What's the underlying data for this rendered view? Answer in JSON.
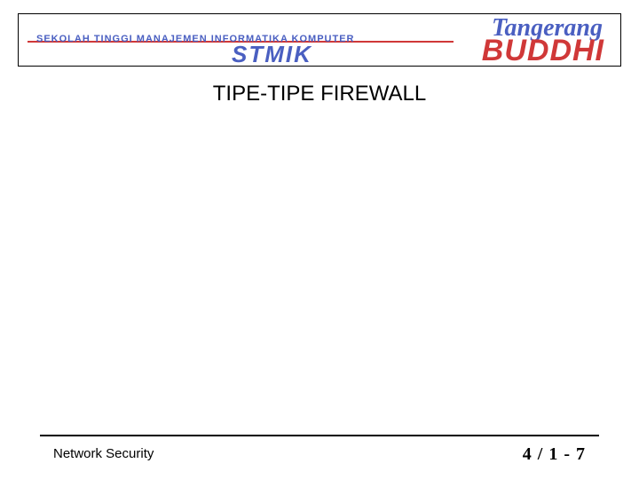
{
  "header": {
    "institution_line": "SEKOLAH TINGGI MANAJEMEN INFORMATIKA KOMPUTER",
    "stmik": "STMIK",
    "buddhi": "BUDDHI",
    "tangerang": "Tangerang"
  },
  "title": "TIPE-TIPE FIREWALL",
  "footer": {
    "left": "Network Security",
    "right": "4 / 1 - 7"
  }
}
